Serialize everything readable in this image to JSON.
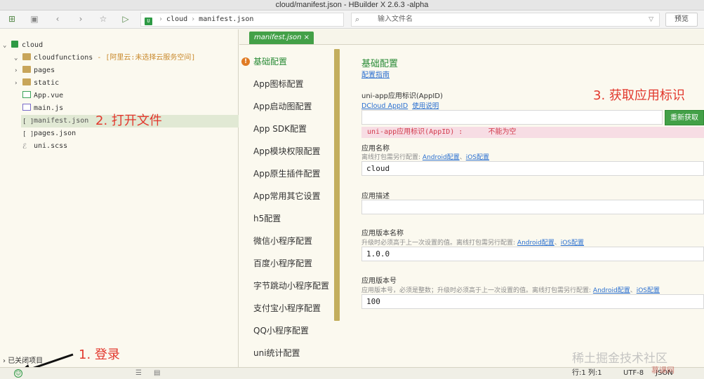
{
  "window": {
    "title": "cloud/manifest.json - HBuilder X 2.6.3 -alpha"
  },
  "toolbar": {
    "breadcrumb": {
      "project_badge": "U",
      "project": "cloud",
      "file": "manifest.json"
    },
    "search": {
      "placeholder": "输入文件名"
    },
    "preview_label": "预览"
  },
  "sidebar": {
    "project": "cloud",
    "items": [
      {
        "label": "cloudfunctions",
        "note": " - [阿里云:未选择云服务空间]",
        "type": "folder"
      },
      {
        "label": "pages",
        "type": "folder"
      },
      {
        "label": "static",
        "type": "folder"
      },
      {
        "label": "App.vue",
        "type": "vue"
      },
      {
        "label": "main.js",
        "type": "js"
      },
      {
        "label": "manifest.json",
        "type": "json"
      },
      {
        "label": "pages.json",
        "type": "json"
      },
      {
        "label": "uni.scss",
        "type": "scss"
      }
    ],
    "closed_projects": "已关闭项目"
  },
  "tab": {
    "label": "manifest.json",
    "close": "×"
  },
  "nav": {
    "items": [
      "基础配置",
      "App图标配置",
      "App启动图配置",
      "App SDK配置",
      "App模块权限配置",
      "App原生插件配置",
      "App常用其它设置",
      "h5配置",
      "微信小程序配置",
      "百度小程序配置",
      "字节跳动小程序配置",
      "支付宝小程序配置",
      "QQ小程序配置",
      "uni统计配置"
    ],
    "warning_mark": "!"
  },
  "form": {
    "title": "基础配置",
    "guide_link": "配置指南",
    "appid": {
      "label": "uni-app应用标识(AppID)",
      "link1": "DCloud AppID",
      "link2": "使用说明",
      "value": "",
      "button": "重新获取",
      "error_label": "uni-app应用标识(AppID) :",
      "error_msg": "不能为空"
    },
    "app_name": {
      "label": "应用名称",
      "hint": "离线打包需另行配置: ",
      "hint_link1": "Android配置",
      "hint_link2": "iOS配置",
      "value": "cloud"
    },
    "app_desc": {
      "label": "应用描述",
      "value": ""
    },
    "version_name": {
      "label": "应用版本名称",
      "hint": "升级时必须高于上一次设置的值。离线打包需另行配置: ",
      "hint_link1": "Android配置",
      "hint_link2": "iOS配置",
      "value": "1.0.0"
    },
    "version_code": {
      "label": "应用版本号",
      "hint": "应用版本号，必须是整数；升级时必须高于上一次设置的值。离线打包需另行配置: ",
      "hint_link1": "Android配置",
      "hint_link2": "iOS配置",
      "value": "100"
    }
  },
  "annotations": {
    "login": "1. 登录",
    "open_file": "2. 打开文件",
    "get_appid": "3. 获取应用标识"
  },
  "statusbar": {
    "position": "行:1  列:1",
    "encoding": "UTF-8",
    "language": "JSON"
  },
  "watermark": {
    "text": "稀土掘金技术社区",
    "logo": "慕课网"
  },
  "colors": {
    "accent": "#43a047",
    "annotation": "#e2382d",
    "link": "#2a6fd0",
    "error_bg": "#f7dde4"
  }
}
